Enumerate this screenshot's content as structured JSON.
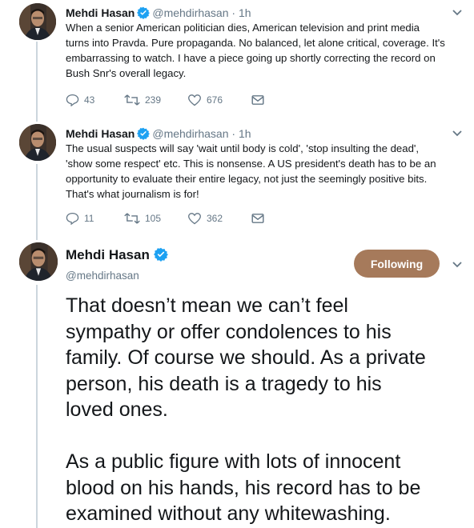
{
  "tweets": [
    {
      "name": "Mehdi Hasan",
      "handle": "@mehdirhasan",
      "sep": "·",
      "time": "1h",
      "text": "When a senior American politician dies, American television and print media\nturns into Pravda. Pure propaganda. No balanced, let alone critical, coverage. It's\nembarrassing to watch. I have a piece going up shortly correcting the record on\nBush Snr's overall legacy.",
      "replies": "43",
      "retweets": "239",
      "likes": "676"
    },
    {
      "name": "Mehdi Hasan",
      "handle": "@mehdirhasan",
      "sep": "·",
      "time": "1h",
      "text": "The usual suspects will say 'wait until body is cold', 'stop insulting the dead',\n'show some respect' etc. This is nonsense. A US president's death has to be an\nopportunity to evaluate their entire legacy, not just the seemingly positive bits.\nThat's what journalism is for!",
      "replies": "11",
      "retweets": "105",
      "likes": "362"
    }
  ],
  "focused": {
    "name": "Mehdi Hasan",
    "handle": "@mehdirhasan",
    "follow_label": "Following",
    "paragraph1": "That doesn’t mean we can’t feel\nsympathy or offer condolences to his\nfamily. Of course we should. As a private\nperson, his death is a tragedy to his\nloved ones.",
    "paragraph2": "As a public figure with lots of innocent\nblood on his hands, his record has to be\nexamined without any whitewashing."
  },
  "icons": {
    "verified": "verified-badge-icon",
    "chevron": "chevron-down-icon",
    "reply": "reply-icon",
    "retweet": "retweet-icon",
    "like": "heart-icon",
    "message": "envelope-icon"
  },
  "colors": {
    "accent": "#1da1f2",
    "follow_button": "#a67a5b",
    "muted": "#657786",
    "thread_line": "#ccd6dd"
  }
}
